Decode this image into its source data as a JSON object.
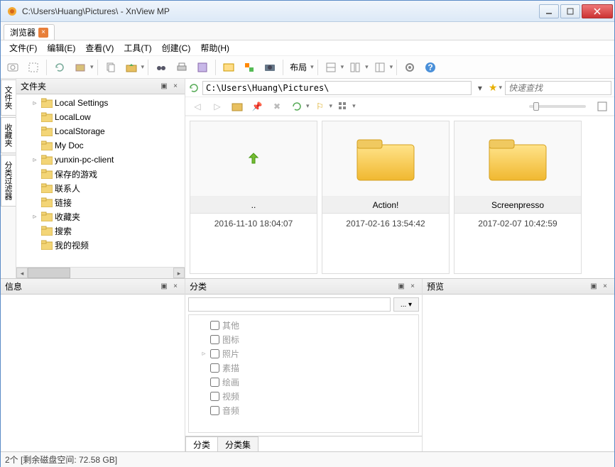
{
  "window": {
    "title": "C:\\Users\\Huang\\Pictures\\ - XnView MP"
  },
  "tab": {
    "label": "浏览器"
  },
  "menu": {
    "file": "文件(F)",
    "edit": "编辑(E)",
    "view": "查看(V)",
    "tools": "工具(T)",
    "create": "创建(C)",
    "help": "帮助(H)"
  },
  "toolbar": {
    "layout_label": "布局"
  },
  "sidetabs": {
    "folders": "文件夹",
    "favorites": "收藏夹",
    "filters": "分类过滤器"
  },
  "folders_panel": {
    "title": "文件夹"
  },
  "tree": {
    "items": [
      {
        "label": "Local Settings",
        "exp": "▹"
      },
      {
        "label": "LocalLow",
        "exp": ""
      },
      {
        "label": "LocalStorage",
        "exp": ""
      },
      {
        "label": "My Doc",
        "exp": ""
      },
      {
        "label": "yunxin-pc-client",
        "exp": "▹"
      },
      {
        "label": "保存的游戏",
        "exp": ""
      },
      {
        "label": "联系人",
        "exp": ""
      },
      {
        "label": "链接",
        "exp": ""
      },
      {
        "label": "收藏夹",
        "exp": "▹"
      },
      {
        "label": "搜索",
        "exp": ""
      },
      {
        "label": "我的视频",
        "exp": ""
      }
    ]
  },
  "address": {
    "path": "C:\\Users\\Huang\\Pictures\\"
  },
  "search": {
    "placeholder": "快速查找"
  },
  "thumbs": [
    {
      "name": "..",
      "date": "2016-11-10 18:04:07",
      "type": "up"
    },
    {
      "name": "Action!",
      "date": "2017-02-16 13:54:42",
      "type": "folder"
    },
    {
      "name": "Screenpresso",
      "date": "2017-02-07 10:42:59",
      "type": "folder"
    }
  ],
  "info_panel": {
    "title": "信息"
  },
  "category_panel": {
    "title": "分类",
    "dots_label": "... ▾",
    "items": [
      "其他",
      "图标",
      "照片",
      "素描",
      "绘画",
      "视频",
      "音频"
    ],
    "tab1": "分类",
    "tab2": "分类集"
  },
  "preview_panel": {
    "title": "预览"
  },
  "status": {
    "text": "2个 [剩余磁盘空间: 72.58 GB]"
  }
}
